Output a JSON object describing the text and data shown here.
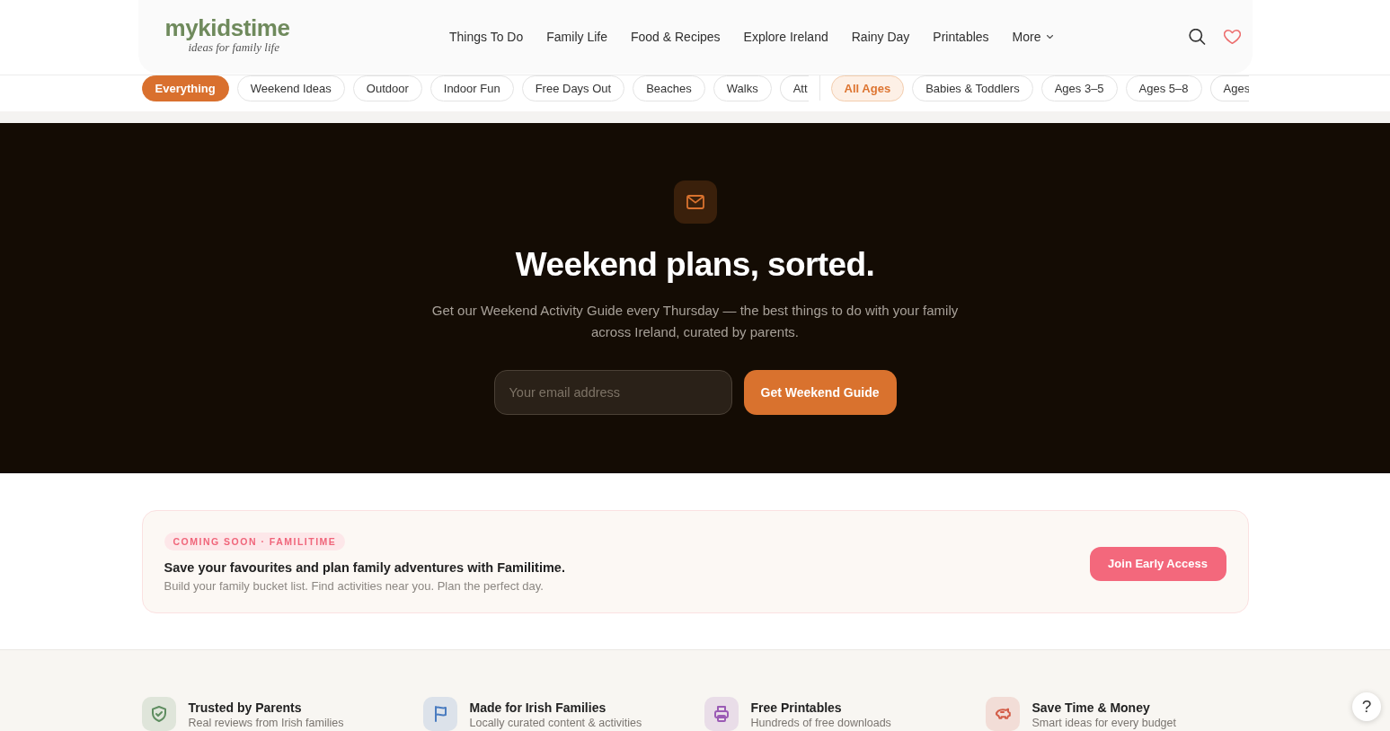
{
  "header": {
    "logo": {
      "wordmark": "mykidstime",
      "tagline": "ideas for family life"
    },
    "nav": [
      {
        "label": "Things To Do",
        "dropdown": false
      },
      {
        "label": "Family Life",
        "dropdown": false
      },
      {
        "label": "Food & Recipes",
        "dropdown": false
      },
      {
        "label": "Explore Ireland",
        "dropdown": false
      },
      {
        "label": "Rainy Day",
        "dropdown": false
      },
      {
        "label": "Printables",
        "dropdown": false
      },
      {
        "label": "More",
        "dropdown": true
      }
    ]
  },
  "topic_filters": [
    {
      "label": "Everything",
      "selected": true
    },
    {
      "label": "Weekend Ideas",
      "selected": false
    },
    {
      "label": "Outdoor",
      "selected": false
    },
    {
      "label": "Indoor Fun",
      "selected": false
    },
    {
      "label": "Free Days Out",
      "selected": false
    },
    {
      "label": "Beaches",
      "selected": false
    },
    {
      "label": "Walks",
      "selected": false
    },
    {
      "label": "Att",
      "selected": false
    }
  ],
  "age_filters": [
    {
      "label": "All Ages",
      "selected": true
    },
    {
      "label": "Babies & Toddlers",
      "selected": false
    },
    {
      "label": "Ages 3–5",
      "selected": false
    },
    {
      "label": "Ages 5–8",
      "selected": false
    },
    {
      "label": "Ages",
      "selected": false
    }
  ],
  "newsletter": {
    "title": "Weekend plans, sorted.",
    "description": "Get our Weekend Activity Guide every Thursday — the best things to do with your family across Ireland, curated by parents.",
    "email_field": {
      "placeholder": "Your email address"
    },
    "button": "Get Weekend Guide"
  },
  "promo": {
    "badge": "COMING SOON · FAMILITIME",
    "title": "Save your favourites and plan family adventures with Familitime.",
    "subtitle": "Build your family bucket list. Find activities near you. Plan the perfect day.",
    "button": "Join Early Access"
  },
  "features": [
    {
      "title": "Trusted by Parents",
      "subtitle": "Real reviews from Irish families",
      "color": "#5e8d60"
    },
    {
      "title": "Made for Irish Families",
      "subtitle": "Locally curated content & activities",
      "color": "#4a7cc0"
    },
    {
      "title": "Free Printables",
      "subtitle": "Hundreds of free downloads",
      "color": "#9b5bb5"
    },
    {
      "title": "Save Time & Money",
      "subtitle": "Smart ideas for every budget",
      "color": "#d35d48"
    }
  ],
  "help_button": "?"
}
